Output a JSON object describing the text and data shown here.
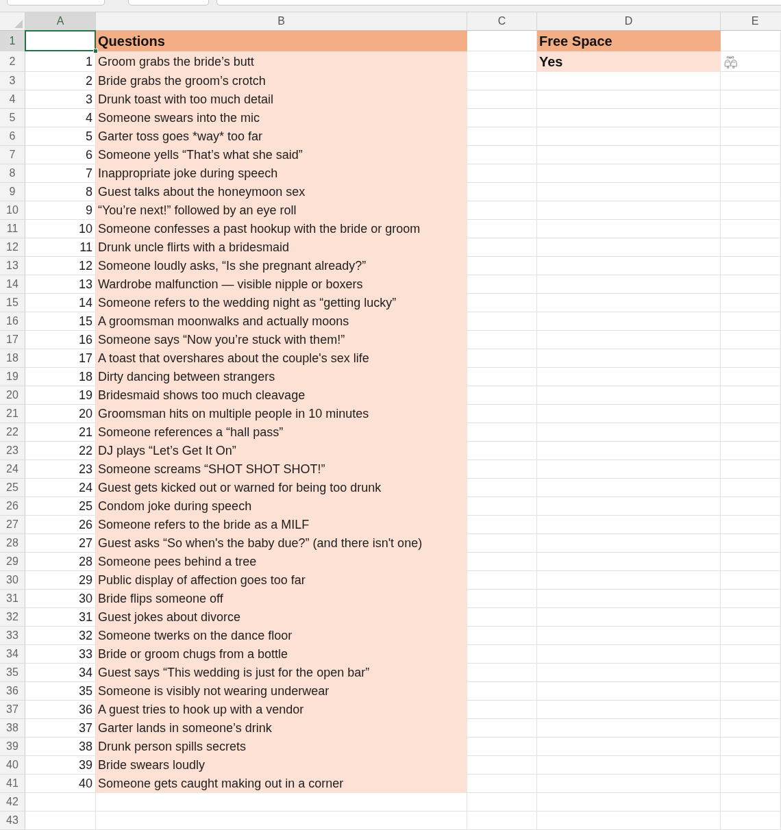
{
  "columns": [
    {
      "label": "A",
      "selected": true
    },
    {
      "label": "B",
      "selected": false
    },
    {
      "label": "C",
      "selected": false
    },
    {
      "label": "D",
      "selected": false
    },
    {
      "label": "E",
      "selected": false
    }
  ],
  "rows": [
    {
      "label": "1",
      "selected": true,
      "cells": [
        {
          "shaded": false
        },
        {
          "text": "Questions",
          "shaded": true,
          "header": true,
          "bold": true
        },
        {
          "shaded": false
        },
        {
          "text": "Free Space",
          "shaded": true,
          "header": true,
          "bold": true
        },
        {
          "shaded": false
        }
      ]
    },
    {
      "label": "2",
      "selected": false,
      "cells": [
        {
          "text": "1",
          "shaded": false
        },
        {
          "text": "Groom grabs the bride’s butt",
          "shaded": true
        },
        {
          "shaded": false
        },
        {
          "text": "Yes",
          "shaded": true,
          "bold": true
        },
        {
          "shaded": false
        }
      ]
    },
    {
      "label": "3",
      "selected": false,
      "cells": [
        {
          "text": "2",
          "shaded": false
        },
        {
          "text": "Bride grabs the groom’s crotch",
          "shaded": true
        },
        {
          "shaded": false
        },
        {
          "shaded": false
        },
        {
          "shaded": false
        }
      ]
    },
    {
      "label": "4",
      "selected": false,
      "cells": [
        {
          "text": "3",
          "shaded": false
        },
        {
          "text": "Drunk toast with too much detail",
          "shaded": true
        },
        {
          "shaded": false
        },
        {
          "shaded": false
        },
        {
          "shaded": false
        }
      ]
    },
    {
      "label": "5",
      "selected": false,
      "cells": [
        {
          "text": "4",
          "shaded": false
        },
        {
          "text": "Someone swears into the mic",
          "shaded": true
        },
        {
          "shaded": false
        },
        {
          "shaded": false
        },
        {
          "shaded": false
        }
      ]
    },
    {
      "label": "6",
      "selected": false,
      "cells": [
        {
          "text": "5",
          "shaded": false
        },
        {
          "text": "Garter toss goes *way* too far",
          "shaded": true
        },
        {
          "shaded": false
        },
        {
          "shaded": false
        },
        {
          "shaded": false
        }
      ]
    },
    {
      "label": "7",
      "selected": false,
      "cells": [
        {
          "text": "6",
          "shaded": false
        },
        {
          "text": "Someone yells “That’s what she said”",
          "shaded": true
        },
        {
          "shaded": false
        },
        {
          "shaded": false
        },
        {
          "shaded": false
        }
      ]
    },
    {
      "label": "8",
      "selected": false,
      "cells": [
        {
          "text": "7",
          "shaded": false
        },
        {
          "text": "Inappropriate joke during speech",
          "shaded": true
        },
        {
          "shaded": false
        },
        {
          "shaded": false
        },
        {
          "shaded": false
        }
      ]
    },
    {
      "label": "9",
      "selected": false,
      "cells": [
        {
          "text": "8",
          "shaded": false
        },
        {
          "text": "Guest talks about the honeymoon sex",
          "shaded": true
        },
        {
          "shaded": false
        },
        {
          "shaded": false
        },
        {
          "shaded": false
        }
      ]
    },
    {
      "label": "10",
      "selected": false,
      "cells": [
        {
          "text": "9",
          "shaded": false
        },
        {
          "text": "“You’re next!” followed by an eye roll",
          "shaded": true
        },
        {
          "shaded": false
        },
        {
          "shaded": false
        },
        {
          "shaded": false
        }
      ]
    },
    {
      "label": "11",
      "selected": false,
      "cells": [
        {
          "text": "10",
          "shaded": false
        },
        {
          "text": "Someone confesses a past hookup with the bride or groom",
          "shaded": true
        },
        {
          "shaded": false
        },
        {
          "shaded": false
        },
        {
          "shaded": false
        }
      ]
    },
    {
      "label": "12",
      "selected": false,
      "cells": [
        {
          "text": "11",
          "shaded": false
        },
        {
          "text": "Drunk uncle flirts with a bridesmaid",
          "shaded": true
        },
        {
          "shaded": false
        },
        {
          "shaded": false
        },
        {
          "shaded": false
        }
      ]
    },
    {
      "label": "13",
      "selected": false,
      "cells": [
        {
          "text": "12",
          "shaded": false
        },
        {
          "text": "Someone loudly asks, “Is she pregnant already?”",
          "shaded": true
        },
        {
          "shaded": false
        },
        {
          "shaded": false
        },
        {
          "shaded": false
        }
      ]
    },
    {
      "label": "14",
      "selected": false,
      "cells": [
        {
          "text": "13",
          "shaded": false
        },
        {
          "text": "Wardrobe malfunction — visible nipple or boxers",
          "shaded": true
        },
        {
          "shaded": false
        },
        {
          "shaded": false
        },
        {
          "shaded": false
        }
      ]
    },
    {
      "label": "15",
      "selected": false,
      "cells": [
        {
          "text": "14",
          "shaded": false
        },
        {
          "text": "Someone refers to the wedding night as “getting lucky”",
          "shaded": true
        },
        {
          "shaded": false
        },
        {
          "shaded": false
        },
        {
          "shaded": false
        }
      ]
    },
    {
      "label": "16",
      "selected": false,
      "cells": [
        {
          "text": "15",
          "shaded": false
        },
        {
          "text": "A groomsman moonwalks and actually moons",
          "shaded": true
        },
        {
          "shaded": false
        },
        {
          "shaded": false
        },
        {
          "shaded": false
        }
      ]
    },
    {
      "label": "17",
      "selected": false,
      "cells": [
        {
          "text": "16",
          "shaded": false
        },
        {
          "text": "Someone says “Now you’re stuck with them!”",
          "shaded": true
        },
        {
          "shaded": false
        },
        {
          "shaded": false
        },
        {
          "shaded": false
        }
      ]
    },
    {
      "label": "18",
      "selected": false,
      "cells": [
        {
          "text": "17",
          "shaded": false
        },
        {
          "text": "A toast that overshares about the couple's sex life",
          "shaded": true
        },
        {
          "shaded": false
        },
        {
          "shaded": false
        },
        {
          "shaded": false
        }
      ]
    },
    {
      "label": "19",
      "selected": false,
      "cells": [
        {
          "text": "18",
          "shaded": false
        },
        {
          "text": "Dirty dancing between strangers",
          "shaded": true
        },
        {
          "shaded": false
        },
        {
          "shaded": false
        },
        {
          "shaded": false
        }
      ]
    },
    {
      "label": "20",
      "selected": false,
      "cells": [
        {
          "text": "19",
          "shaded": false
        },
        {
          "text": "Bridesmaid shows too much cleavage",
          "shaded": true
        },
        {
          "shaded": false
        },
        {
          "shaded": false
        },
        {
          "shaded": false
        }
      ]
    },
    {
      "label": "21",
      "selected": false,
      "cells": [
        {
          "text": "20",
          "shaded": false
        },
        {
          "text": "Groomsman hits on multiple people in 10 minutes",
          "shaded": true
        },
        {
          "shaded": false
        },
        {
          "shaded": false
        },
        {
          "shaded": false
        }
      ]
    },
    {
      "label": "22",
      "selected": false,
      "cells": [
        {
          "text": "21",
          "shaded": false
        },
        {
          "text": "Someone references a “hall pass”",
          "shaded": true
        },
        {
          "shaded": false
        },
        {
          "shaded": false
        },
        {
          "shaded": false
        }
      ]
    },
    {
      "label": "23",
      "selected": false,
      "cells": [
        {
          "text": "22",
          "shaded": false
        },
        {
          "text": "DJ plays “Let’s Get It On”",
          "shaded": true
        },
        {
          "shaded": false
        },
        {
          "shaded": false
        },
        {
          "shaded": false
        }
      ]
    },
    {
      "label": "24",
      "selected": false,
      "cells": [
        {
          "text": "23",
          "shaded": false
        },
        {
          "text": "Someone screams “SHOT SHOT SHOT!”",
          "shaded": true
        },
        {
          "shaded": false
        },
        {
          "shaded": false
        },
        {
          "shaded": false
        }
      ]
    },
    {
      "label": "25",
      "selected": false,
      "cells": [
        {
          "text": "24",
          "shaded": false
        },
        {
          "text": "Guest gets kicked out or warned for being too drunk",
          "shaded": true
        },
        {
          "shaded": false
        },
        {
          "shaded": false
        },
        {
          "shaded": false
        }
      ]
    },
    {
      "label": "26",
      "selected": false,
      "cells": [
        {
          "text": "25",
          "shaded": false
        },
        {
          "text": "Condom joke during speech",
          "shaded": true
        },
        {
          "shaded": false
        },
        {
          "shaded": false
        },
        {
          "shaded": false
        }
      ]
    },
    {
      "label": "27",
      "selected": false,
      "cells": [
        {
          "text": "26",
          "shaded": false
        },
        {
          "text": "Someone refers to the bride as a MILF",
          "shaded": true
        },
        {
          "shaded": false
        },
        {
          "shaded": false
        },
        {
          "shaded": false
        }
      ]
    },
    {
      "label": "28",
      "selected": false,
      "cells": [
        {
          "text": "27",
          "shaded": false
        },
        {
          "text": "Guest asks “So when's the baby due?” (and there isn't one)",
          "shaded": true
        },
        {
          "shaded": false
        },
        {
          "shaded": false
        },
        {
          "shaded": false
        }
      ]
    },
    {
      "label": "29",
      "selected": false,
      "cells": [
        {
          "text": "28",
          "shaded": false
        },
        {
          "text": "Someone pees behind a tree",
          "shaded": true
        },
        {
          "shaded": false
        },
        {
          "shaded": false
        },
        {
          "shaded": false
        }
      ]
    },
    {
      "label": "30",
      "selected": false,
      "cells": [
        {
          "text": "29",
          "shaded": false
        },
        {
          "text": "Public display of affection goes too far",
          "shaded": true
        },
        {
          "shaded": false
        },
        {
          "shaded": false
        },
        {
          "shaded": false
        }
      ]
    },
    {
      "label": "31",
      "selected": false,
      "cells": [
        {
          "text": "30",
          "shaded": false
        },
        {
          "text": "Bride flips someone off",
          "shaded": true
        },
        {
          "shaded": false
        },
        {
          "shaded": false
        },
        {
          "shaded": false
        }
      ]
    },
    {
      "label": "32",
      "selected": false,
      "cells": [
        {
          "text": "31",
          "shaded": false
        },
        {
          "text": "Guest jokes about divorce",
          "shaded": true
        },
        {
          "shaded": false
        },
        {
          "shaded": false
        },
        {
          "shaded": false
        }
      ]
    },
    {
      "label": "33",
      "selected": false,
      "cells": [
        {
          "text": "32",
          "shaded": false
        },
        {
          "text": "Someone twerks on the dance floor",
          "shaded": true
        },
        {
          "shaded": false
        },
        {
          "shaded": false
        },
        {
          "shaded": false
        }
      ]
    },
    {
      "label": "34",
      "selected": false,
      "cells": [
        {
          "text": "33",
          "shaded": false
        },
        {
          "text": "Bride or groom chugs from a bottle",
          "shaded": true
        },
        {
          "shaded": false
        },
        {
          "shaded": false
        },
        {
          "shaded": false
        }
      ]
    },
    {
      "label": "35",
      "selected": false,
      "cells": [
        {
          "text": "34",
          "shaded": false
        },
        {
          "text": "Guest says “This wedding is just for the open bar”",
          "shaded": true
        },
        {
          "shaded": false
        },
        {
          "shaded": false
        },
        {
          "shaded": false
        }
      ]
    },
    {
      "label": "36",
      "selected": false,
      "cells": [
        {
          "text": "35",
          "shaded": false
        },
        {
          "text": "Someone is visibly not wearing underwear",
          "shaded": true
        },
        {
          "shaded": false
        },
        {
          "shaded": false
        },
        {
          "shaded": false
        }
      ]
    },
    {
      "label": "37",
      "selected": false,
      "cells": [
        {
          "text": "36",
          "shaded": false
        },
        {
          "text": "A guest tries to hook up with a vendor",
          "shaded": true
        },
        {
          "shaded": false
        },
        {
          "shaded": false
        },
        {
          "shaded": false
        }
      ]
    },
    {
      "label": "38",
      "selected": false,
      "cells": [
        {
          "text": "37",
          "shaded": false
        },
        {
          "text": "Garter lands in someone’s drink",
          "shaded": true
        },
        {
          "shaded": false
        },
        {
          "shaded": false
        },
        {
          "shaded": false
        }
      ]
    },
    {
      "label": "39",
      "selected": false,
      "cells": [
        {
          "text": "38",
          "shaded": false
        },
        {
          "text": "Drunk person spills secrets",
          "shaded": true
        },
        {
          "shaded": false
        },
        {
          "shaded": false
        },
        {
          "shaded": false
        }
      ]
    },
    {
      "label": "40",
      "selected": false,
      "cells": [
        {
          "text": "39",
          "shaded": false
        },
        {
          "text": "Bride swears loudly",
          "shaded": true
        },
        {
          "shaded": false
        },
        {
          "shaded": false
        },
        {
          "shaded": false
        }
      ]
    },
    {
      "label": "41",
      "selected": false,
      "cells": [
        {
          "text": "40",
          "shaded": false
        },
        {
          "text": "Someone gets caught making out in a corner",
          "shaded": true
        },
        {
          "shaded": false
        },
        {
          "shaded": false
        },
        {
          "shaded": false
        }
      ]
    },
    {
      "label": "42",
      "selected": false,
      "cells": [
        {
          "shaded": false
        },
        {
          "shaded": false
        },
        {
          "shaded": false
        },
        {
          "shaded": false
        },
        {
          "shaded": false
        }
      ]
    },
    {
      "label": "43",
      "selected": false,
      "cells": [
        {
          "shaded": false
        },
        {
          "shaded": false
        },
        {
          "shaded": false
        },
        {
          "shaded": false
        },
        {
          "shaded": false
        }
      ]
    }
  ]
}
